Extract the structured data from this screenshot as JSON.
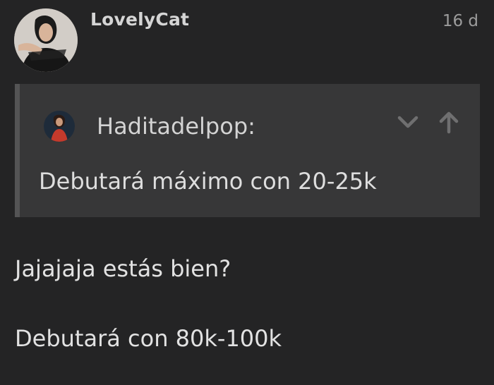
{
  "post": {
    "author": "LovelyCat",
    "time_ago": "16 d",
    "avatar_icon": "woman-portrait-avatar-icon"
  },
  "quote": {
    "author": "Haditadelpop:",
    "text": "Debutará máximo con 20-25k",
    "avatar_icon": "red-dress-woman-avatar-icon",
    "collapse_icon": "chevron-down-icon",
    "jump_icon": "arrow-up-icon"
  },
  "body": {
    "lines": [
      "Jajajaja estás bien?",
      "Debutará con 80k-100k"
    ]
  },
  "colors": {
    "background": "#242425",
    "quote_background": "#373738",
    "quote_border": "#545455",
    "username": "#d5d5d5",
    "timestamp": "#9c9c9c",
    "text": "#e2e2e2"
  }
}
